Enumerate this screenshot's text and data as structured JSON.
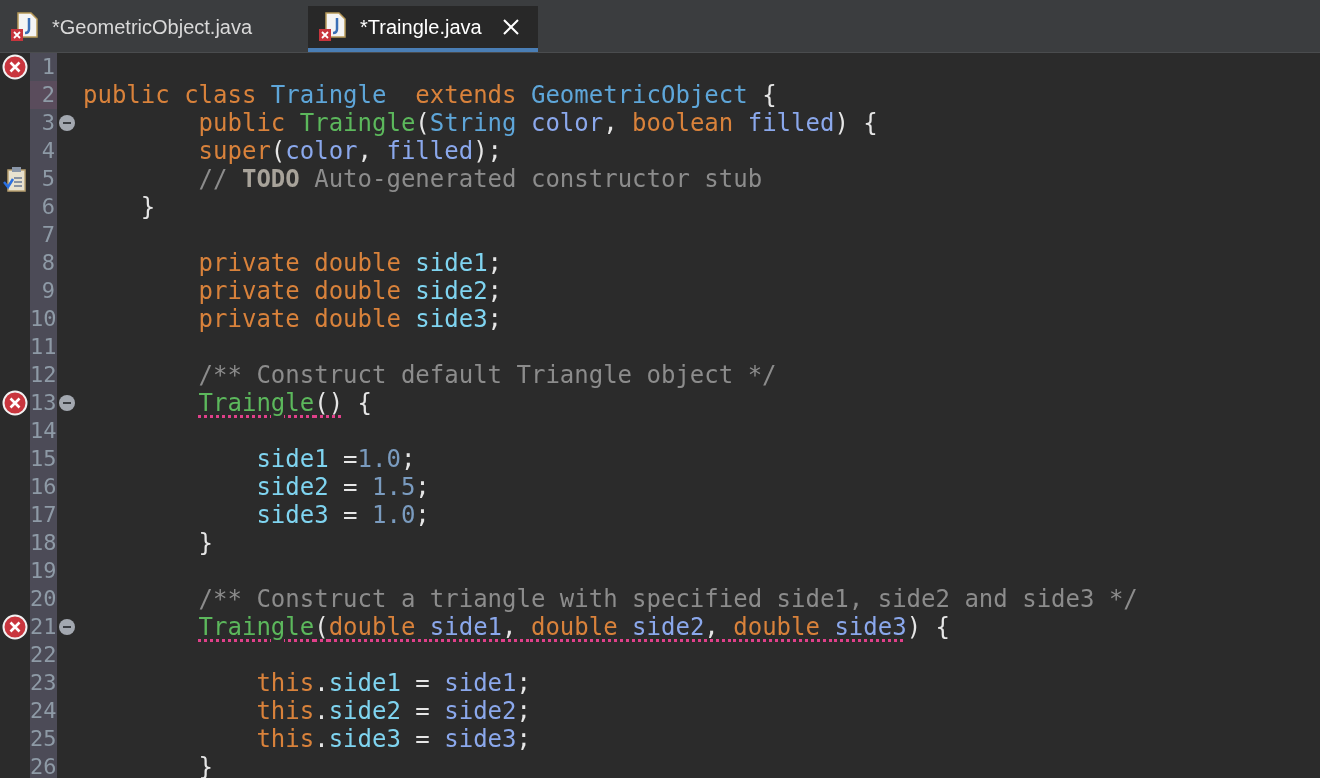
{
  "tabs": [
    {
      "label": "*GeometricObject.java",
      "selected": false,
      "closable": false
    },
    {
      "label": "*Traingle.java",
      "selected": true,
      "closable": true
    }
  ],
  "lines": [
    {
      "number": "1",
      "kind": "error",
      "fold": false,
      "current": false
    },
    {
      "number": "2",
      "kind": "plain",
      "fold": false,
      "current": true,
      "tokens": [
        {
          "kind": "keyword",
          "text": "public class "
        },
        {
          "kind": "type",
          "text": "Traingle"
        },
        {
          "kind": "keyword",
          "text": "  extends "
        },
        {
          "kind": "type",
          "text": "GeometricObject"
        },
        {
          "kind": "plain",
          "text": " {"
        }
      ]
    },
    {
      "number": "3",
      "kind": "plain",
      "fold": true,
      "current": false,
      "tokens": [
        {
          "kind": "keyword",
          "text": "        public "
        },
        {
          "kind": "method",
          "text": "Traingle"
        },
        {
          "kind": "plain",
          "text": "("
        },
        {
          "kind": "type",
          "text": "String"
        },
        {
          "kind": "param",
          "text": " color"
        },
        {
          "kind": "plain",
          "text": ", "
        },
        {
          "kind": "keyword",
          "text": "boolean "
        },
        {
          "kind": "param",
          "text": "filled"
        },
        {
          "kind": "plain",
          "text": ") {"
        }
      ]
    },
    {
      "number": "4",
      "kind": "plain",
      "fold": false,
      "current": false,
      "tokens": [
        {
          "kind": "keyword",
          "text": "        super"
        },
        {
          "kind": "plain",
          "text": "("
        },
        {
          "kind": "param",
          "text": "color"
        },
        {
          "kind": "plain",
          "text": ", "
        },
        {
          "kind": "param",
          "text": "filled"
        },
        {
          "kind": "plain",
          "text": ");"
        }
      ]
    },
    {
      "number": "5",
      "kind": "task",
      "fold": false,
      "current": false,
      "tokens": [
        {
          "kind": "comment",
          "text": "        // "
        },
        {
          "kind": "todo",
          "text": "TODO"
        },
        {
          "kind": "comment",
          "text": " Auto-generated constructor stub"
        }
      ]
    },
    {
      "number": "6",
      "kind": "plain",
      "fold": false,
      "current": false,
      "tokens": [
        {
          "kind": "plain",
          "text": "    }"
        }
      ]
    },
    {
      "number": "7",
      "kind": "plain",
      "fold": false,
      "current": false
    },
    {
      "number": "8",
      "kind": "plain",
      "fold": false,
      "current": false,
      "tokens": [
        {
          "kind": "keyword",
          "text": "        private double "
        },
        {
          "kind": "field",
          "text": "side1"
        },
        {
          "kind": "plain",
          "text": ";"
        }
      ]
    },
    {
      "number": "9",
      "kind": "plain",
      "fold": false,
      "current": false,
      "tokens": [
        {
          "kind": "keyword",
          "text": "        private double "
        },
        {
          "kind": "field",
          "text": "side2"
        },
        {
          "kind": "plain",
          "text": ";"
        }
      ]
    },
    {
      "number": "10",
      "kind": "plain",
      "fold": false,
      "current": false,
      "tokens": [
        {
          "kind": "keyword",
          "text": "        private double "
        },
        {
          "kind": "field",
          "text": "side3"
        },
        {
          "kind": "plain",
          "text": ";"
        }
      ]
    },
    {
      "number": "11",
      "kind": "plain",
      "fold": false,
      "current": false
    },
    {
      "number": "12",
      "kind": "plain",
      "fold": false,
      "current": false,
      "tokens": [
        {
          "kind": "comment",
          "text": "        /** Construct default Triangle object */"
        }
      ]
    },
    {
      "number": "13",
      "kind": "error",
      "fold": true,
      "current": false,
      "tokens": [
        {
          "kind": "method",
          "text": "        Traingle",
          "error": true
        },
        {
          "kind": "plain",
          "text": "()",
          "error": true
        },
        {
          "kind": "plain",
          "text": " {",
          "error": false
        }
      ]
    },
    {
      "number": "14",
      "kind": "plain",
      "fold": false,
      "current": false
    },
    {
      "number": "15",
      "kind": "plain",
      "fold": false,
      "current": false,
      "tokens": [
        {
          "kind": "field",
          "text": "            side1"
        },
        {
          "kind": "plain",
          "text": " ="
        },
        {
          "kind": "number",
          "text": "1.0"
        },
        {
          "kind": "plain",
          "text": ";"
        }
      ]
    },
    {
      "number": "16",
      "kind": "plain",
      "fold": false,
      "current": false,
      "tokens": [
        {
          "kind": "field",
          "text": "            side2"
        },
        {
          "kind": "plain",
          "text": " = "
        },
        {
          "kind": "number",
          "text": "1.5"
        },
        {
          "kind": "plain",
          "text": ";"
        }
      ]
    },
    {
      "number": "17",
      "kind": "plain",
      "fold": false,
      "current": false,
      "tokens": [
        {
          "kind": "field",
          "text": "            side3"
        },
        {
          "kind": "plain",
          "text": " = "
        },
        {
          "kind": "number",
          "text": "1.0"
        },
        {
          "kind": "plain",
          "text": ";"
        }
      ]
    },
    {
      "number": "18",
      "kind": "plain",
      "fold": false,
      "current": false,
      "tokens": [
        {
          "kind": "plain",
          "text": "        }"
        }
      ]
    },
    {
      "number": "19",
      "kind": "plain",
      "fold": false,
      "current": false
    },
    {
      "number": "20",
      "kind": "plain",
      "fold": false,
      "current": false,
      "tokens": [
        {
          "kind": "comment",
          "text": "        /** Construct a triangle with specified side1, side2 and side3 */"
        }
      ]
    },
    {
      "number": "21",
      "kind": "error",
      "fold": true,
      "current": false,
      "tokens": [
        {
          "kind": "method",
          "text": "        Traingle",
          "error": true
        },
        {
          "kind": "plain",
          "text": "(",
          "error": true
        },
        {
          "kind": "keyword",
          "text": "double ",
          "error": true
        },
        {
          "kind": "param",
          "text": "side1",
          "error": true
        },
        {
          "kind": "plain",
          "text": ", ",
          "error": true
        },
        {
          "kind": "keyword",
          "text": "double ",
          "error": true
        },
        {
          "kind": "param",
          "text": "side2",
          "error": true
        },
        {
          "kind": "plain",
          "text": ", ",
          "error": true
        },
        {
          "kind": "keyword",
          "text": "double ",
          "error": true
        },
        {
          "kind": "param",
          "text": "side3",
          "error": true
        },
        {
          "kind": "plain",
          "text": ") {",
          "error": false
        }
      ]
    },
    {
      "number": "22",
      "kind": "plain",
      "fold": false,
      "current": false
    },
    {
      "number": "23",
      "kind": "plain",
      "fold": false,
      "current": false,
      "tokens": [
        {
          "kind": "keyword",
          "text": "            this"
        },
        {
          "kind": "plain",
          "text": "."
        },
        {
          "kind": "field",
          "text": "side1"
        },
        {
          "kind": "plain",
          "text": " = "
        },
        {
          "kind": "param",
          "text": "side1"
        },
        {
          "kind": "plain",
          "text": ";"
        }
      ]
    },
    {
      "number": "24",
      "kind": "plain",
      "fold": false,
      "current": false,
      "tokens": [
        {
          "kind": "keyword",
          "text": "            this"
        },
        {
          "kind": "plain",
          "text": "."
        },
        {
          "kind": "field",
          "text": "side2"
        },
        {
          "kind": "plain",
          "text": " = "
        },
        {
          "kind": "param",
          "text": "side2"
        },
        {
          "kind": "plain",
          "text": ";"
        }
      ]
    },
    {
      "number": "25",
      "kind": "plain",
      "fold": false,
      "current": false,
      "tokens": [
        {
          "kind": "keyword",
          "text": "            this"
        },
        {
          "kind": "plain",
          "text": "."
        },
        {
          "kind": "field",
          "text": "side3"
        },
        {
          "kind": "plain",
          "text": " = "
        },
        {
          "kind": "param",
          "text": "side3"
        },
        {
          "kind": "plain",
          "text": ";"
        }
      ]
    },
    {
      "number": "26",
      "kind": "plain",
      "fold": false,
      "current": false,
      "tokens": [
        {
          "kind": "plain",
          "text": "        }"
        }
      ]
    }
  ]
}
